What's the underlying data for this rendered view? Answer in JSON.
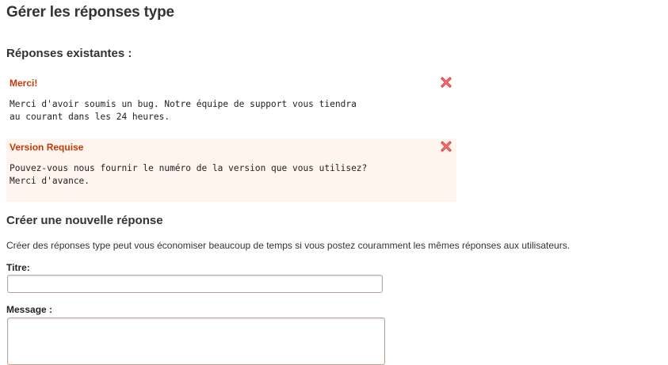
{
  "page": {
    "title": "Gérer les réponses type"
  },
  "existing": {
    "heading": "Réponses existantes :",
    "responses": [
      {
        "title": "Merci!",
        "body": "Merci d'avoir soumis un bug. Notre équipe de support vous tiendra\nau courant dans les 24 heures.",
        "delete_icon": "delete-x-icon"
      },
      {
        "title": "Version Requise",
        "body": "Pouvez-vous nous fournir le numéro de la version que vous utilisez?\nMerci d'avance.",
        "delete_icon": "delete-x-icon"
      }
    ]
  },
  "new_response": {
    "heading": "Créer une nouvelle réponse",
    "help": "Créer des réponses type peut vous économiser beaucoup de temps si vous postez couramment les mêmes réponses aux utilisateurs.",
    "title_label": "Titre:",
    "title_value": "",
    "message_label": "Message :",
    "message_value": ""
  },
  "colors": {
    "accent_title": "#c23a0b",
    "delete_icon": "#e0454a",
    "alt_row_bg": "#fff5ee",
    "input_border": "#b7a496"
  }
}
